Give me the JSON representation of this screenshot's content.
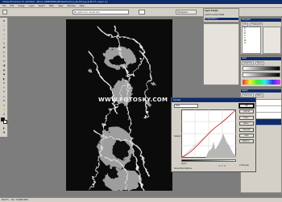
{
  "window": {
    "title": "Adobe Photoshop CS (Untitled) - [Book_ISBN09BN3A|Bildbearbeitung_Bl_004.jpg @ 66.7% (Layer 1)]"
  },
  "menu": [
    "File",
    "Edit",
    "Image",
    "Layer",
    "Select",
    "Filter",
    "View",
    "Window",
    "Help"
  ],
  "options": {
    "field_value": "No options for current tool",
    "workspace_label": "Workspace"
  },
  "tools": [
    "move-tool",
    "marquee-tool",
    "lasso-tool",
    "magic-wand-tool",
    "crop-tool",
    "slice-tool",
    "healing-brush-tool",
    "brush-tool",
    "clone-stamp-tool",
    "history-brush-tool",
    "eraser-tool",
    "gradient-tool",
    "blur-tool",
    "dodge-tool",
    "path-selection-tool",
    "type-tool",
    "pen-tool",
    "shape-tool",
    "notes-tool",
    "eyedropper-tool",
    "hand-tool",
    "zoom-tool"
  ],
  "tool_glyphs": [
    "✥",
    "⬚",
    "ϙ",
    "✧",
    "⌗",
    "✎",
    "✚",
    "✍",
    "♁",
    "⟲",
    "◪",
    "▤",
    "◉",
    "◐",
    "➤",
    "T",
    "✒",
    "▭",
    "✉",
    "✑",
    "✋",
    "⚲"
  ],
  "colors": {
    "foreground": "#111111",
    "background": "#ffffff",
    "accent": "#0c2c6c",
    "curve_red": "#c83a3a"
  },
  "panels": {
    "layer_comps": {
      "rows": [
        "Layer Comps",
        "Last Document State",
        "Composition 1"
      ]
    },
    "navigator": {
      "title": "Navigator",
      "tabs": [
        "Info",
        "Histogram"
      ],
      "lines": [
        "R:",
        "G:",
        "B:",
        "X:",
        "Y:",
        "W:",
        "H:"
      ]
    },
    "color": {
      "title": "Color",
      "tabs": [
        "Swatches",
        "Styles"
      ]
    },
    "layers": {
      "title": "Layers",
      "tabs": [
        "Channels",
        "Paths"
      ],
      "rows": [
        "RGB",
        "Red",
        "Green",
        "Blue"
      ],
      "selected": "Blue"
    }
  },
  "curves_dialog": {
    "title": "Curves",
    "channel": "RGB",
    "buttons": [
      "OK",
      "Cancel",
      "Load...",
      "Save...",
      "Smooth",
      "Auto",
      "Options..."
    ],
    "input_label": "Input:",
    "output_label": "Output:",
    "preview_label": "Preview",
    "show_more_label": "Show More Options"
  },
  "watermark": "WWW.FOTOSKY.COM",
  "status": {
    "zoom": "66.67%",
    "doc": "Doc: 3.04M/6.09M"
  }
}
